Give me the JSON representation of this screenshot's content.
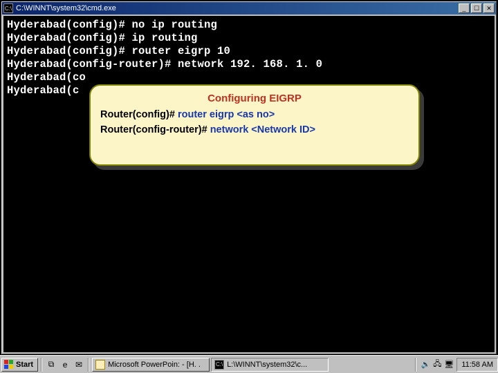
{
  "window": {
    "title": "C:\\WINNT\\system32\\cmd.exe",
    "sys_icon": "C:\\"
  },
  "terminal": {
    "lines": [
      {
        "prompt": "Hyderabad(config)#",
        "cmd": "no ip routing"
      },
      {
        "prompt": "Hyderabad(config)#",
        "cmd": "ip routing"
      },
      {
        "prompt": "Hyderabad(config)#",
        "cmd": "router eigrp 10"
      },
      {
        "prompt": "Hyderabad(config-router)#",
        "cmd": "network 192. 168. 1. 0"
      },
      {
        "prompt": "Hyderabad(co",
        "cmd": ""
      },
      {
        "prompt": "Hyderabad(c",
        "cmd": ""
      }
    ]
  },
  "callout": {
    "title": "Configuring EIGRP",
    "line1_prompt": "Router(config)# ",
    "line1_cmd": "router eigrp <as no>",
    "line2_prompt": "Router(config-router)# ",
    "line2_cmd": "network <Network ID>"
  },
  "taskbar": {
    "start": "Start",
    "quicklaunch": [
      {
        "name": "show-desktop-icon",
        "glyph": "⧉"
      },
      {
        "name": "ie-icon",
        "glyph": "e"
      },
      {
        "name": "outlook-icon",
        "glyph": "✉"
      }
    ],
    "tasks": [
      {
        "label": "Microsoft PowerPoin: - [H. .",
        "pressed": false,
        "ic": "pp"
      },
      {
        "label": "L:\\WINNT\\system32\\c...",
        "pressed": true,
        "ic": "cmd"
      }
    ],
    "tray": [
      {
        "name": "volume-icon",
        "glyph": "🔊"
      },
      {
        "name": "network-icon",
        "glyph": "🖧"
      },
      {
        "name": "pc-icon",
        "glyph": "🖥"
      }
    ],
    "clock": "11:58 AM"
  }
}
